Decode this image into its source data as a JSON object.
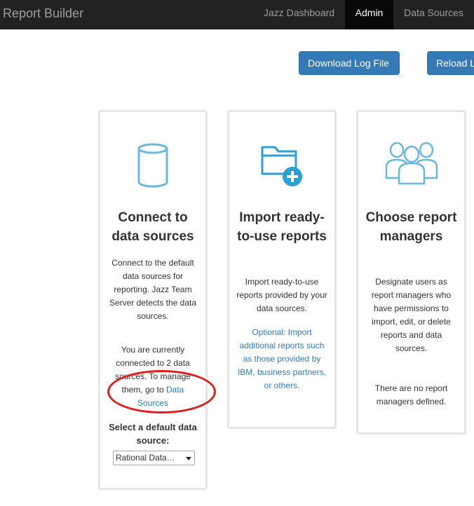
{
  "navbar": {
    "brand": "Report Builder",
    "items": [
      {
        "label": "Jazz Dashboard",
        "active": false
      },
      {
        "label": "Admin",
        "active": true
      },
      {
        "label": "Data Sources",
        "active": false
      }
    ]
  },
  "toolbar": {
    "download_label": "Download Log File",
    "reload_label": "Reload Log"
  },
  "cards": [
    {
      "icon": "database-icon",
      "title": "Connect to data sources",
      "p1": "Connect to the default data sources for reporting. Jazz Team Server detects the data sources.",
      "p2_prefix": "You are currently connected to 2 data sources. To manage them, go to ",
      "p2_link": "Data Sources",
      "select_label": "Select a default data source:",
      "select_value": "Rational Data…"
    },
    {
      "icon": "folder-add-icon",
      "title": "Import ready-to-use reports",
      "p1": "Import ready-to-use reports provided by your data sources.",
      "p2_link": "Optional: Import additional reports such as those provided by IBM, business partners, or others."
    },
    {
      "icon": "users-group-icon",
      "title": "Choose report managers",
      "p1": "Designate users as report managers who have permissions to import, edit, or delete reports and data sources.",
      "p2": "There are no report managers defined."
    }
  ],
  "colors": {
    "navbar_bg": "#222222",
    "accent": "#337ab7",
    "icon": "#6ab7dd",
    "annotation": "#e31b1b"
  }
}
